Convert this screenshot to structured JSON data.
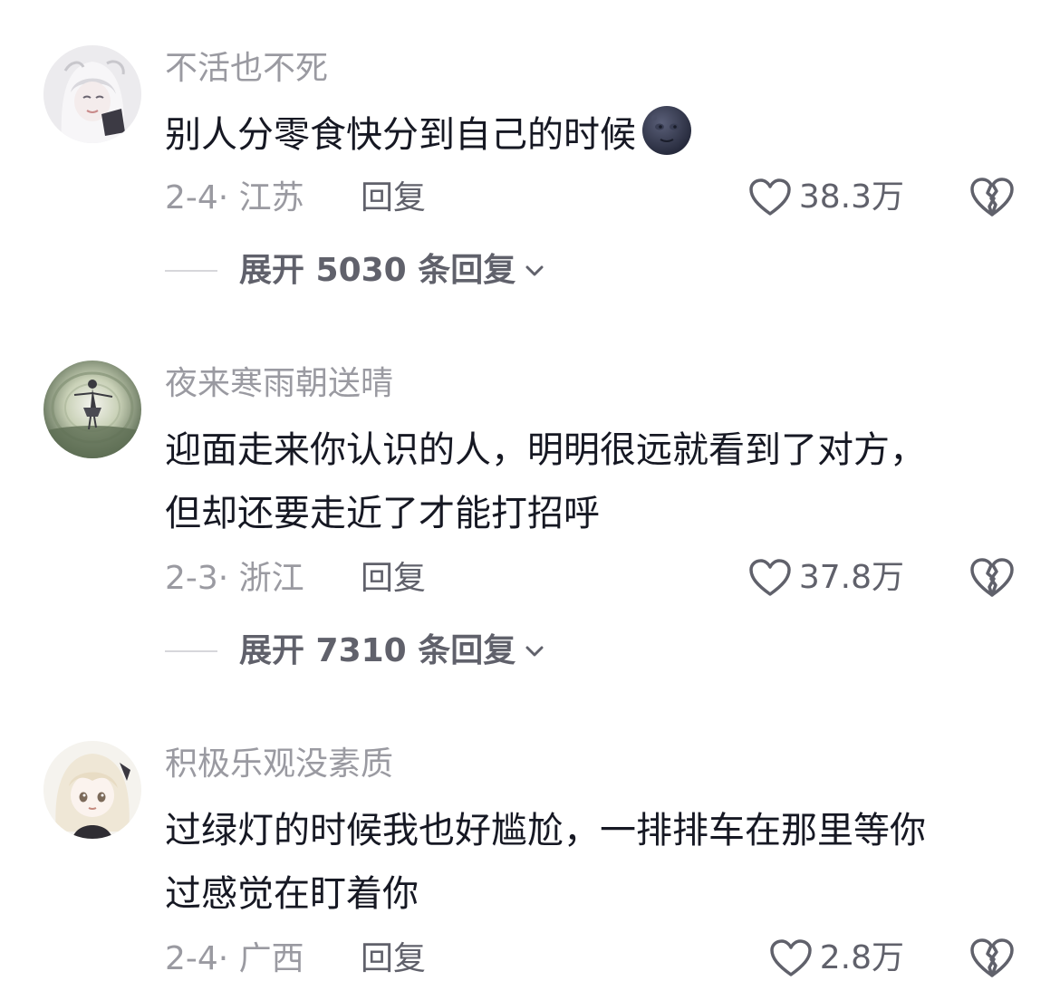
{
  "comments": [
    {
      "username": "不活也不死",
      "text_lines": [
        "别人分零食快分到自己的时候"
      ],
      "emoji": "new-moon-face-emoji",
      "date_location": "2-4· 江苏",
      "reply_label": "回复",
      "likes": "38.3万",
      "expand_label": "展开 5030 条回复",
      "avatar_icon": "anime-avatar-white-hair"
    },
    {
      "username": "夜来寒雨朝送晴",
      "text_lines": [
        "迎面走来你认识的人，明明很远就看到了对方，",
        "但却还要走近了才能打招呼"
      ],
      "date_location": "2-3· 浙江",
      "reply_label": "回复",
      "likes": "37.8万",
      "expand_label": "展开 7310 条回复",
      "avatar_icon": "dancer-avatar-green"
    },
    {
      "username": "积极乐观没素质",
      "text_lines": [
        "过绿灯的时候我也好尴尬，一排排车在那里等你",
        "过感觉在盯着你"
      ],
      "date_location": "2-4· 广西",
      "reply_label": "回复",
      "likes": "2.8万",
      "avatar_icon": "anime-avatar-cream-hair"
    }
  ],
  "icons": {
    "like": "heart-outline-icon",
    "dislike": "broken-heart-icon",
    "expand": "chevron-down-icon"
  },
  "colors": {
    "primary_text": "#161823",
    "secondary_text": "#9a9aa1",
    "action_text": "#60616b"
  }
}
